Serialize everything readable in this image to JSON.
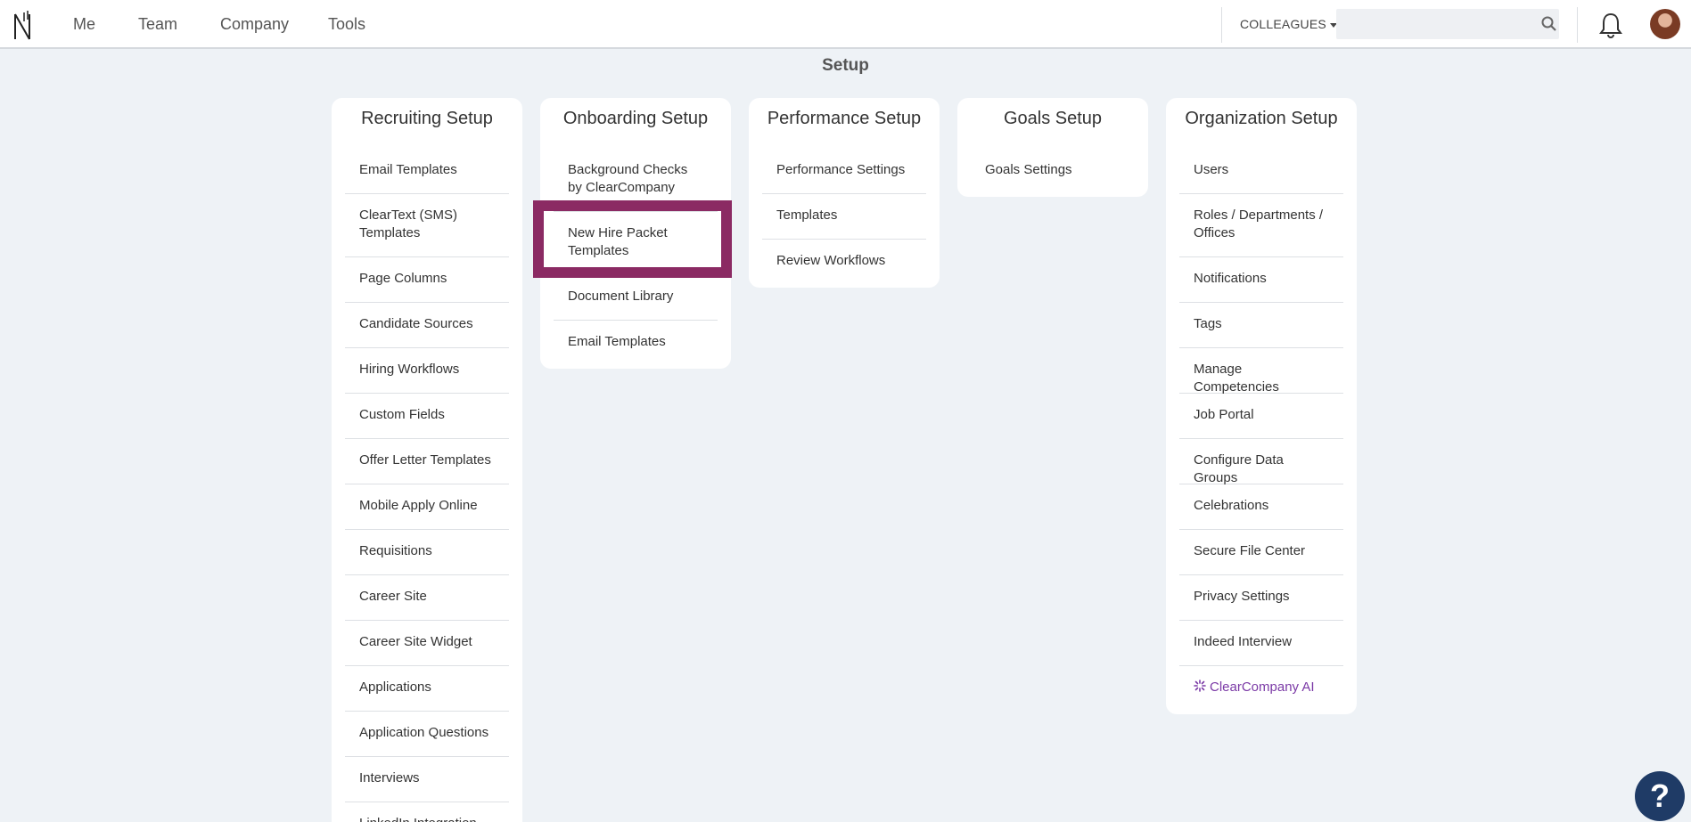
{
  "nav": {
    "items": [
      "Me",
      "Team",
      "Company",
      "Tools"
    ],
    "colleagues_label": "COLLEAGUES",
    "search_placeholder": ""
  },
  "page_title": "Setup",
  "cards": [
    {
      "title": "Recruiting Setup",
      "items": [
        "Email Templates",
        "ClearText (SMS) Templates",
        "Page Columns",
        "Candidate Sources",
        "Hiring Workflows",
        "Custom Fields",
        "Offer Letter Templates",
        "Mobile Apply Online",
        "Requisitions",
        "Career Site",
        "Career Site Widget",
        "Applications",
        "Application Questions",
        "Interviews",
        "LinkedIn Integration"
      ]
    },
    {
      "title": "Onboarding Setup",
      "items": [
        "Background Checks by ClearCompany",
        "New Hire Packet Templates",
        "Document Library",
        "Email Templates"
      ]
    },
    {
      "title": "Performance Setup",
      "items": [
        "Performance Settings",
        "Templates",
        "Review Workflows"
      ]
    },
    {
      "title": "Goals Setup",
      "items": [
        "Goals Settings"
      ]
    },
    {
      "title": "Organization Setup",
      "items": [
        "Users",
        "Roles / Departments / Offices",
        "Notifications",
        "Tags",
        "Manage Competencies",
        "Job Portal",
        "Configure Data Groups",
        "Celebrations",
        "Secure File Center",
        "Privacy Settings",
        "Indeed Interview",
        "ClearCompany AI"
      ]
    }
  ],
  "help_label": "?",
  "colors": {
    "highlight": "#8b2a63",
    "ai_accent": "#7b3aa6",
    "help_bg": "#1f3b66",
    "page_bg": "#eef2f6"
  }
}
